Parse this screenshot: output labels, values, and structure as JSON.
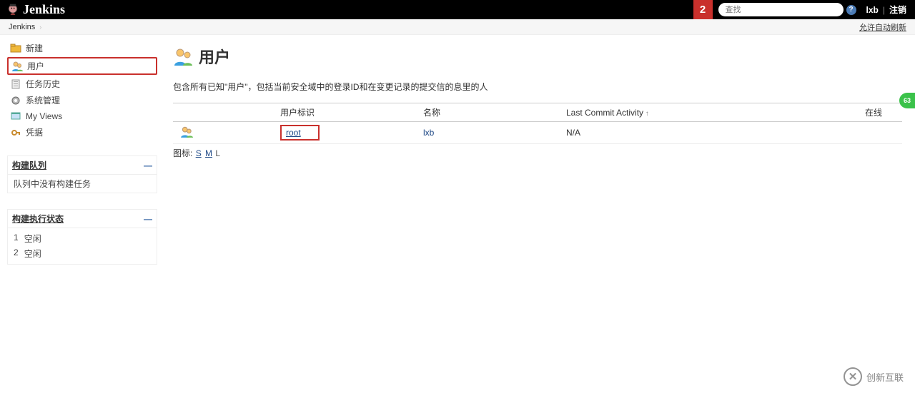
{
  "header": {
    "brand": "Jenkins",
    "alert_count": "2",
    "search_placeholder": "查找",
    "username": "lxb",
    "logout": "注销"
  },
  "breadcrumb": {
    "root": "Jenkins",
    "auto_refresh": "允许自动刷新"
  },
  "sidebar": {
    "tasks": [
      {
        "label": "新建",
        "icon": "folder-new-icon",
        "active": false
      },
      {
        "label": "用户",
        "icon": "user-icon",
        "active": true
      },
      {
        "label": "任务历史",
        "icon": "clipboard-icon",
        "active": false
      },
      {
        "label": "系统管理",
        "icon": "gear-icon",
        "active": false
      },
      {
        "label": "My Views",
        "icon": "views-icon",
        "active": false
      },
      {
        "label": "凭据",
        "icon": "credentials-icon",
        "active": false
      }
    ],
    "queue": {
      "title": "构建队列",
      "empty_text": "队列中没有构建任务"
    },
    "executors": {
      "title": "构建执行状态",
      "rows": [
        {
          "num": "1",
          "state": "空闲"
        },
        {
          "num": "2",
          "state": "空闲"
        }
      ]
    }
  },
  "main": {
    "title": "用户",
    "description": "包含所有已知\"用户\"，包括当前安全域中的登录ID和在变更记录的提交信的息里的人",
    "columns": {
      "icon": "",
      "user_id": "用户标识",
      "name": "名称",
      "last_commit": "Last Commit Activity",
      "online": "在线"
    },
    "rows": [
      {
        "user_id": "root",
        "name": "lxb",
        "last_commit": "N/A",
        "online": ""
      }
    ],
    "icon_size_label": "图标:",
    "icon_sizes": [
      "S",
      "M",
      "L"
    ]
  },
  "watermark": {
    "text": "创新互联"
  },
  "side_badge": {
    "text": "63"
  }
}
